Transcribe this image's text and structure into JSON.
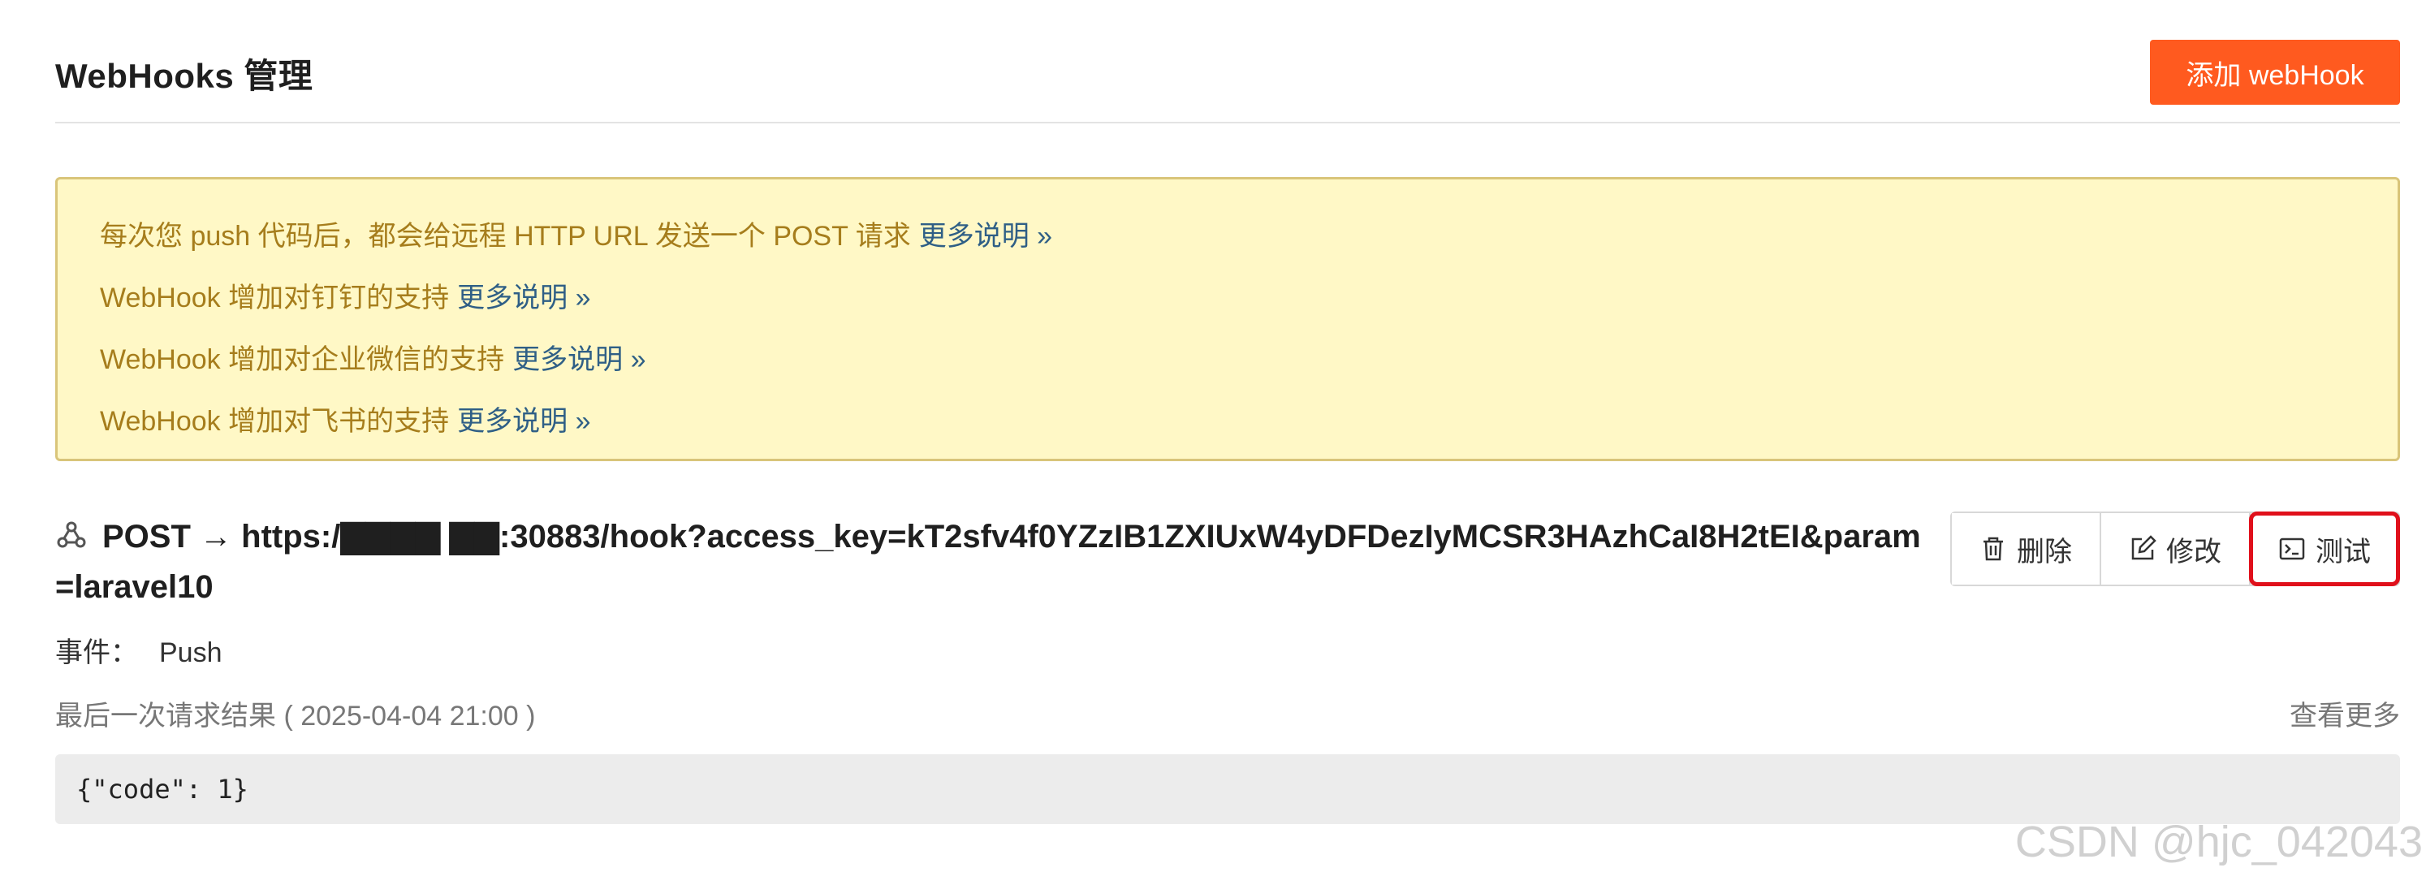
{
  "header": {
    "title": "WebHooks 管理",
    "add_button": "添加 webHook"
  },
  "notice": {
    "lines": [
      {
        "text": "每次您 push 代码后，都会给远程 HTTP URL 发送一个 POST 请求",
        "link": "更多说明 »"
      },
      {
        "text": "WebHook 增加对钉钉的支持",
        "link": "更多说明 »"
      },
      {
        "text": "WebHook 增加对企业微信的支持",
        "link": "更多说明 »"
      },
      {
        "text": "WebHook 增加对飞书的支持",
        "link": "更多说明 »"
      }
    ],
    "colors": {
      "background": "#fff8c6",
      "border": "#d9c57a",
      "text": "#a67d1c",
      "link": "#2f5f86"
    }
  },
  "hook": {
    "icon": "webhook-icon",
    "url": "POST → https:/▇▇▇▇ ▇▇:30883/hook?access_key=kT2sfv4f0YZzIB1ZXIUxW4yDFDezIyMCSR3HAzhCaI8H2tEI&param=laravel10",
    "actions": {
      "delete": {
        "icon": "trash-icon",
        "label": "删除"
      },
      "edit": {
        "icon": "edit-icon",
        "label": "修改"
      },
      "test": {
        "icon": "terminal-icon",
        "label": "测试"
      }
    },
    "event_label": "事件：",
    "event_value": "Push",
    "last_result_label": "最后一次请求结果 ( 2025-04-04 21:00 )",
    "view_more": "查看更多",
    "response": "{\"code\": 1}"
  },
  "watermark": "CSDN @hjc_042043",
  "colors": {
    "primary": "#ff5a1f",
    "highlight": "#e0101b"
  }
}
